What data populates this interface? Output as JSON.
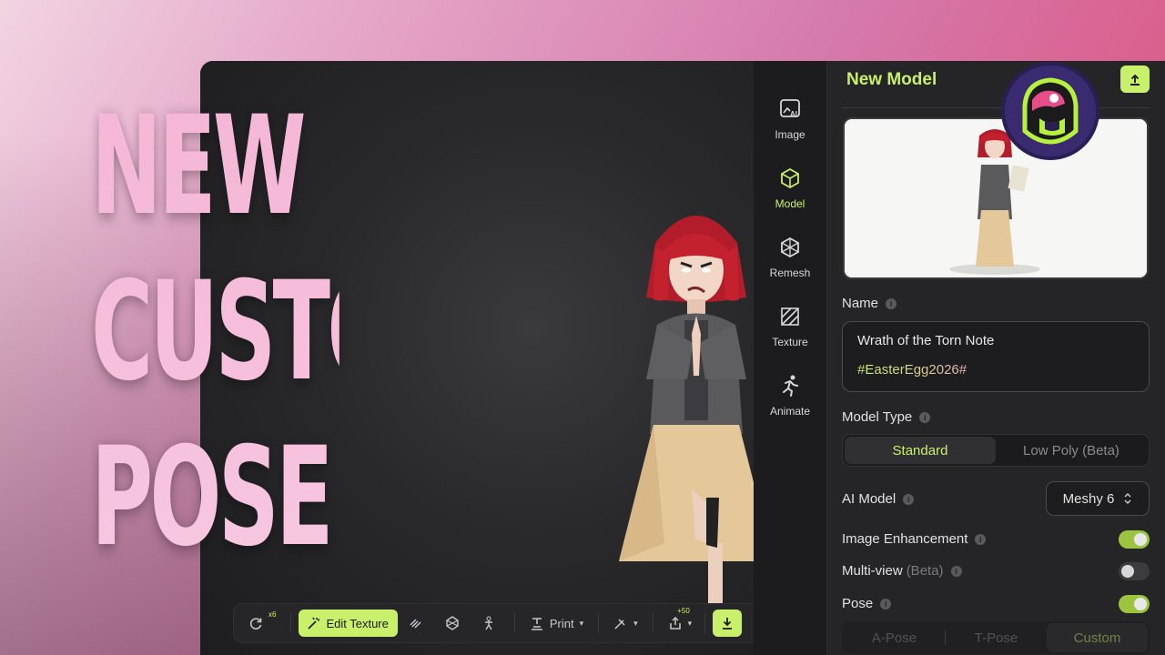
{
  "overlay": {
    "line1": "NEW",
    "line2": "CUSTOM",
    "line3": "POSE"
  },
  "rail": {
    "items": [
      {
        "label": "Image",
        "icon": "ai-image-icon"
      },
      {
        "label": "Model",
        "icon": "cube-icon"
      },
      {
        "label": "Remesh",
        "icon": "remesh-icon"
      },
      {
        "label": "Texture",
        "icon": "texture-icon"
      },
      {
        "label": "Animate",
        "icon": "running-person-icon"
      }
    ],
    "active": "Model"
  },
  "panel": {
    "title": "New Model",
    "name_label": "Name",
    "name_value": "Wrath of the Torn Note",
    "name_tag": "#EasterEgg2026#",
    "model_type_label": "Model Type",
    "model_type_options": [
      "Standard",
      "Low Poly (Beta)"
    ],
    "model_type_selected": "Standard",
    "ai_model_label": "AI Model",
    "ai_model_value": "Meshy 6",
    "image_enhancement_label": "Image Enhancement",
    "image_enhancement_on": true,
    "multiview_label": "Multi-view",
    "multiview_suffix": "(Beta)",
    "multiview_on": false,
    "pose_label": "Pose",
    "pose_on": true,
    "pose_options": [
      "A-Pose",
      "T-Pose",
      "Custom"
    ],
    "pose_selected": "Custom"
  },
  "toolbar": {
    "refresh_badge": "x6",
    "edit_texture": "Edit Texture",
    "print": "Print",
    "export_badge": "+50"
  },
  "colors": {
    "accent": "#c9f06a",
    "panel_bg": "#252527",
    "viewport_bg": "#29292b"
  }
}
